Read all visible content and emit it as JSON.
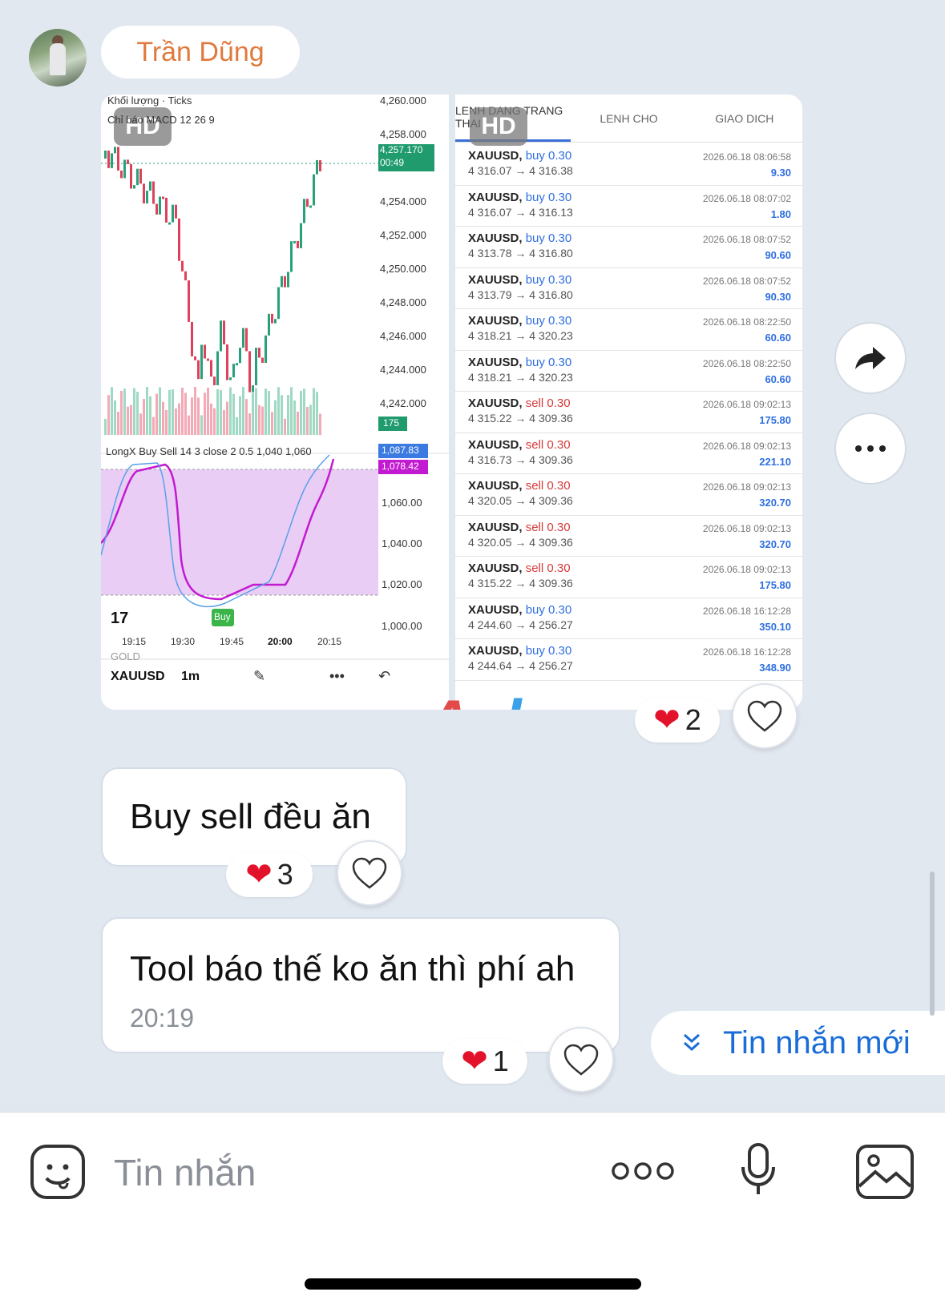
{
  "sender": {
    "name": "Trần Dũng"
  },
  "image_message": {
    "hd_label": "HD",
    "chart": {
      "header_line1": "Khối lượng · Ticks",
      "header_line2": "Chỉ báo MACD 12 26 9",
      "price_labels": [
        "4,260.000",
        "4,258.000",
        "4,254.000",
        "4,252.000",
        "4,250.000",
        "4,248.000",
        "4,246.000",
        "4,244.000",
        "4,242.000"
      ],
      "current_price": "4,257.170",
      "current_timer": "00:49",
      "volume_badge": "175",
      "indicator_label": "LongX Buy Sell 14 3 close 2 0.5 1,040 1,060",
      "indicator_values": [
        "1,087.83",
        "1,078.42"
      ],
      "indicator_axis": [
        "1,060.00",
        "1,040.00",
        "1,020.00",
        "1,000.00"
      ],
      "buy_tag": "Buy",
      "time_labels": [
        "19:15",
        "19:30",
        "19:45",
        "20:00",
        "20:15"
      ],
      "symbol": "XAUUSD",
      "timeframe": "1m",
      "gold_label": "GOLD"
    },
    "trades": {
      "tabs": [
        "LENH DANG TRANG THAI",
        "LENH CHO",
        "GIAO DICH"
      ],
      "rows": [
        {
          "symbol": "XAUUSD,",
          "side": "buy",
          "volume": "0.30",
          "prices": "4 316.07 → 4 316.38",
          "time": "2026.06.18 08:06:58",
          "profit": "9.30"
        },
        {
          "symbol": "XAUUSD,",
          "side": "buy",
          "volume": "0.30",
          "prices": "4 316.07 → 4 316.13",
          "time": "2026.06.18 08:07:02",
          "profit": "1.80"
        },
        {
          "symbol": "XAUUSD,",
          "side": "buy",
          "volume": "0.30",
          "prices": "4 313.78 → 4 316.80",
          "time": "2026.06.18 08:07:52",
          "profit": "90.60"
        },
        {
          "symbol": "XAUUSD,",
          "side": "buy",
          "volume": "0.30",
          "prices": "4 313.79 → 4 316.80",
          "time": "2026.06.18 08:07:52",
          "profit": "90.30"
        },
        {
          "symbol": "XAUUSD,",
          "side": "buy",
          "volume": "0.30",
          "prices": "4 318.21 → 4 320.23",
          "time": "2026.06.18 08:22:50",
          "profit": "60.60"
        },
        {
          "symbol": "XAUUSD,",
          "side": "buy",
          "volume": "0.30",
          "prices": "4 318.21 → 4 320.23",
          "time": "2026.06.18 08:22:50",
          "profit": "60.60"
        },
        {
          "symbol": "XAUUSD,",
          "side": "sell",
          "volume": "0.30",
          "prices": "4 315.22 → 4 309.36",
          "time": "2026.06.18 09:02:13",
          "profit": "175.80"
        },
        {
          "symbol": "XAUUSD,",
          "side": "sell",
          "volume": "0.30",
          "prices": "4 316.73 → 4 309.36",
          "time": "2026.06.18 09:02:13",
          "profit": "221.10"
        },
        {
          "symbol": "XAUUSD,",
          "side": "sell",
          "volume": "0.30",
          "prices": "4 320.05 → 4 309.36",
          "time": "2026.06.18 09:02:13",
          "profit": "320.70"
        },
        {
          "symbol": "XAUUSD,",
          "side": "sell",
          "volume": "0.30",
          "prices": "4 320.05 → 4 309.36",
          "time": "2026.06.18 09:02:13",
          "profit": "320.70"
        },
        {
          "symbol": "XAUUSD,",
          "side": "sell",
          "volume": "0.30",
          "prices": "4 315.22 → 4 309.36",
          "time": "2026.06.18 09:02:13",
          "profit": "175.80"
        },
        {
          "symbol": "XAUUSD,",
          "side": "buy",
          "volume": "0.30",
          "prices": "4 244.60 → 4 256.27",
          "time": "2026.06.18 16:12:28",
          "profit": "350.10"
        },
        {
          "symbol": "XAUUSD,",
          "side": "buy",
          "volume": "0.30",
          "prices": "4 244.64 → 4 256.27",
          "time": "2026.06.18 16:12:28",
          "profit": "348.90"
        }
      ]
    },
    "reaction_count": "2"
  },
  "watermark": {
    "part1": "Ap",
    "part2": "hang"
  },
  "messages": [
    {
      "text": "Buy sell đều ăn",
      "reaction_count": "3"
    },
    {
      "text": "Tool báo thế ko ăn thì phí ah",
      "time": "20:19",
      "reaction_count": "1"
    }
  ],
  "new_messages_label": "Tin nhắn mới",
  "composer": {
    "placeholder": "Tin nhắn"
  },
  "colors": {
    "accent": "#1a6cd8",
    "name": "#e07a3c",
    "heart": "#e3122b",
    "buy": "#2f6fe0",
    "sell": "#d63a3a"
  }
}
